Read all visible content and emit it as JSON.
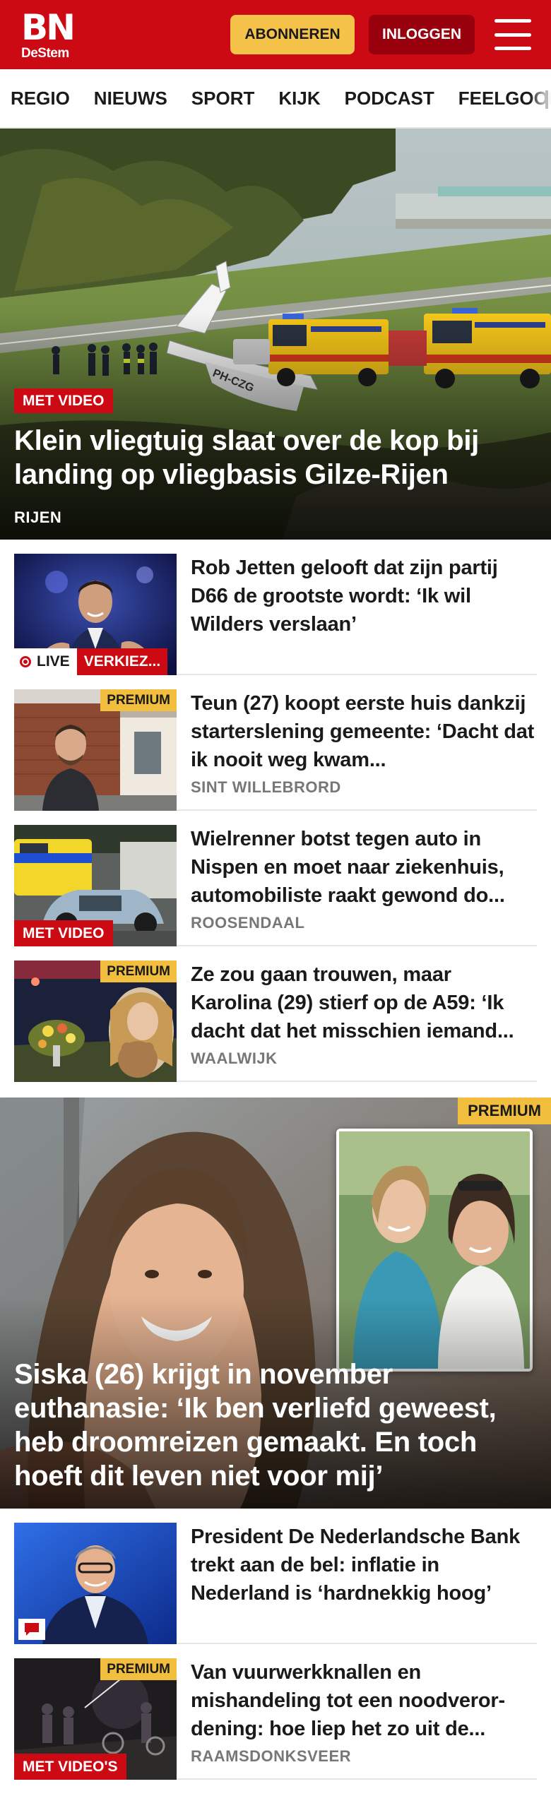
{
  "header": {
    "logo_main": "BN",
    "logo_sub": "DeStem",
    "subscribe_label": "ABONNEREN",
    "login_label": "INLOGGEN"
  },
  "nav": {
    "items": [
      "REGIO",
      "NIEUWS",
      "SPORT",
      "KIJK",
      "PODCAST",
      "FEELGOOD"
    ]
  },
  "hero": {
    "badge": "MET VIDEO",
    "title": "Klein vliegtuig slaat over de kop bij landing op vliegbasis Gilze-Rijen",
    "location": "RIJEN",
    "plane_registration": "PH-CZG"
  },
  "articles": [
    {
      "title": "Rob Jetten gelooft dat zijn partij D66 de grootste wordt: ‘Ik wil Wilders verslaan’",
      "live_label": "LIVE",
      "live_tag": "VERKIEZ..."
    },
    {
      "title": "Teun (27) koopt eerste huis dankzij starterslening gemeente: ‘Dacht dat ik nooit weg kwam...",
      "location": "SINT WILLEBRORD",
      "premium": "PREMIUM"
    },
    {
      "title": "Wielrenner botst tegen auto in Nispen en moet naar ziekenhuis, automobiliste raakt gewond do...",
      "location": "ROOSENDAAL",
      "badge": "MET VIDEO"
    },
    {
      "title": "Ze zou gaan trouwen, maar Karolina (29) stierf op de A59: ‘Ik dacht dat het misschien iemand...",
      "location": "WAALWIJK",
      "premium": "PREMIUM"
    }
  ],
  "feature": {
    "premium": "PREMIUM",
    "title": "Siska (26) krijgt in november euthanasie: ‘Ik ben verliefd geweest, heb droomreizen gemaakt. En toch hoeft dit leven niet voor mij’"
  },
  "articles2": [
    {
      "title": "President De Nederlandsche Bank trekt aan de bel: inflatie in Nederland is ‘hardnekkig hoog’"
    },
    {
      "title": "Van vuurwerkknallen en mishandeling tot een noodveror-dening: hoe liep het zo uit de...",
      "location": "RAAMSDONKSVEER",
      "premium": "PREMIUM",
      "badge": "MET VIDEO'S"
    }
  ],
  "colors": {
    "brand_red": "#cc0a14",
    "dark_red": "#98000d",
    "premium_yellow": "#f2be3d",
    "subscribe_yellow": "#f6c34a"
  }
}
